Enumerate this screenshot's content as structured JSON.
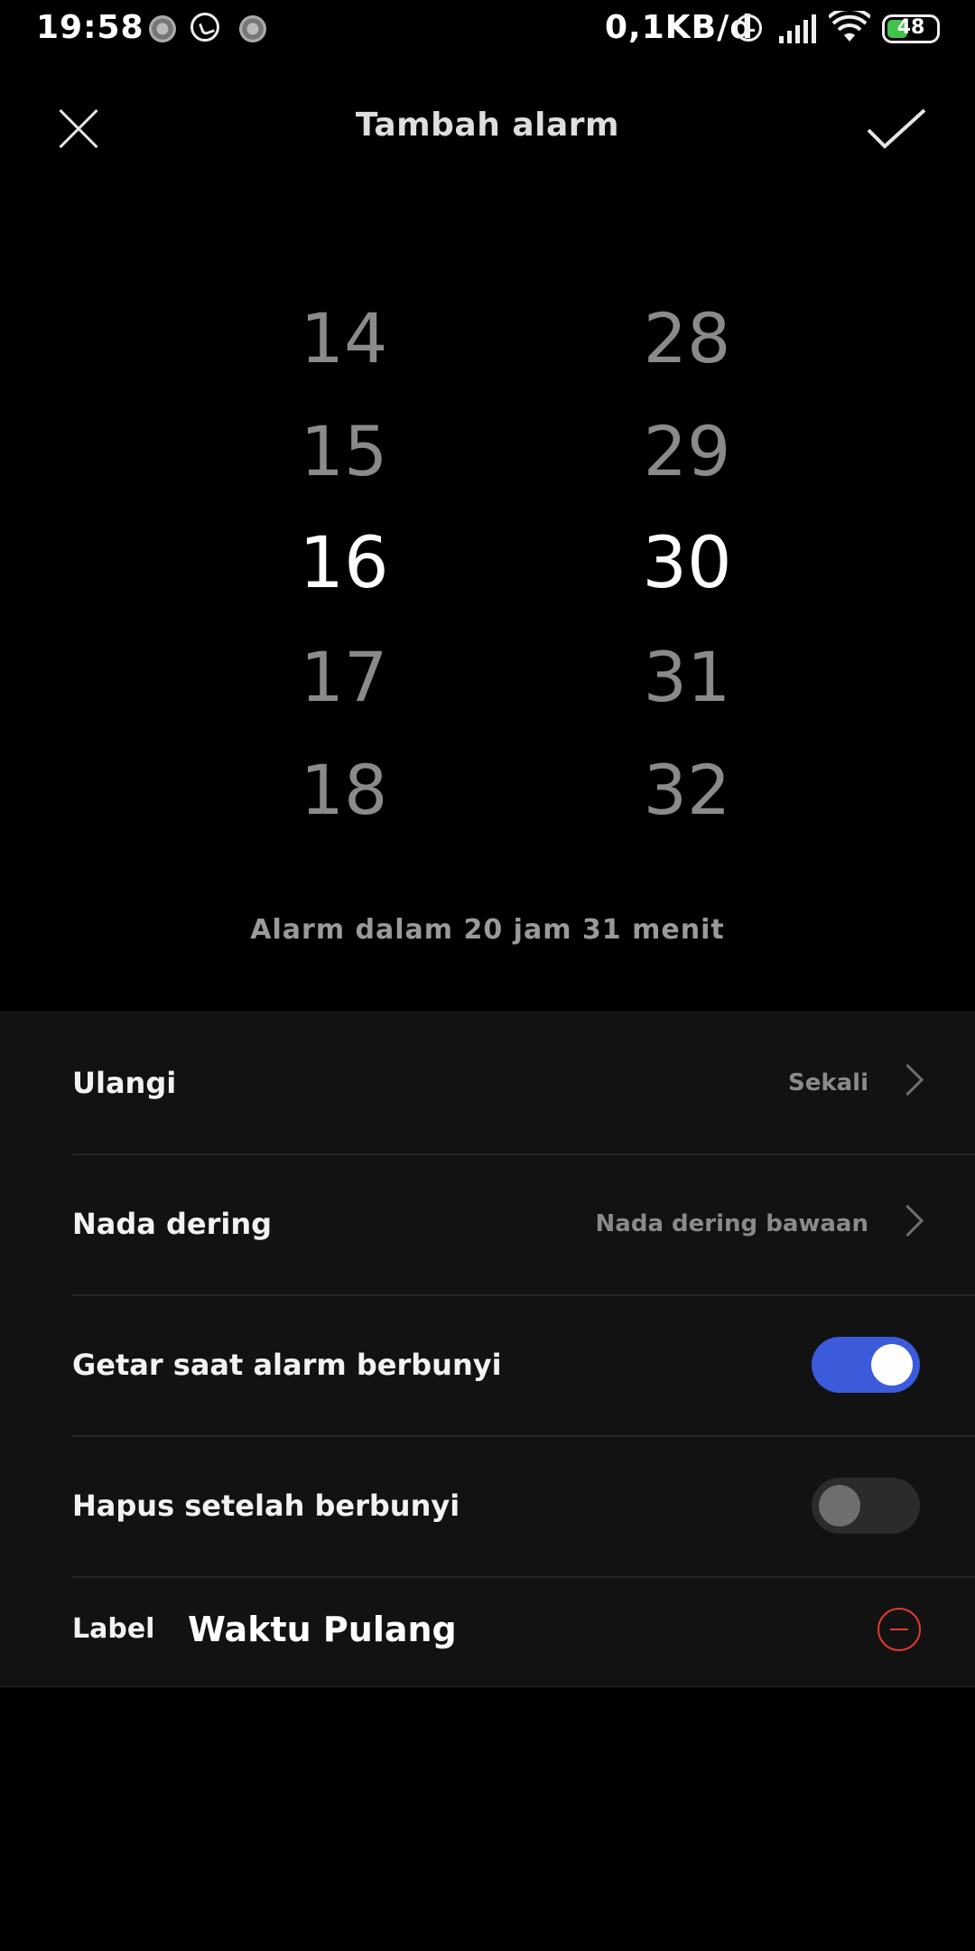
{
  "status_bar": {
    "time": "19:58",
    "net_speed": "0,1KB/d",
    "battery": "48",
    "battery_color": "#3ec44a"
  },
  "header": {
    "title": "Tambah alarm",
    "close_icon": "close-icon",
    "confirm_icon": "check-icon"
  },
  "picker": {
    "hours": [
      "14",
      "15",
      "16",
      "17",
      "18"
    ],
    "minutes": [
      "28",
      "29",
      "30",
      "31",
      "32"
    ],
    "selected_hour": "16",
    "selected_minute": "30"
  },
  "countdown_text": "Alarm dalam 20 jam 31 menit",
  "settings": {
    "repeat": {
      "label": "Ulangi",
      "value": "Sekali"
    },
    "ringtone": {
      "label": "Nada dering",
      "value": "Nada dering bawaan"
    },
    "vibrate": {
      "label": "Getar saat alarm berbunyi",
      "on": true
    },
    "delete_after": {
      "label": "Hapus setelah berbunyi",
      "on": false
    },
    "alarm_label": {
      "label": "Label",
      "value": "Waktu Pulang"
    }
  },
  "colors": {
    "accent": "#3b5bdb",
    "danger": "#e03a2d"
  }
}
